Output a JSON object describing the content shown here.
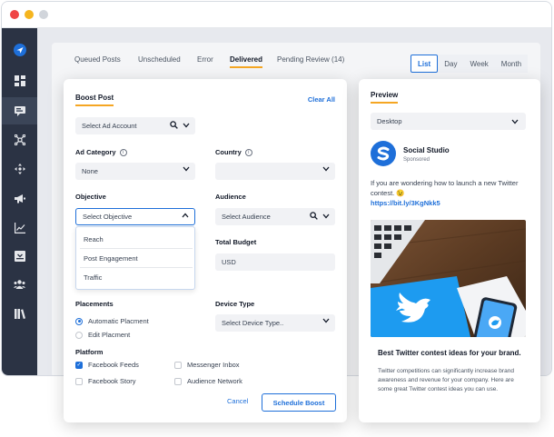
{
  "nav": {
    "tabs": [
      "Queued Posts",
      "Unscheduled",
      "Error",
      "Delivered",
      "Pending Review (14)"
    ],
    "views": [
      "List",
      "Day",
      "Week",
      "Month"
    ]
  },
  "boost": {
    "title": "Boost Post",
    "clear_all": "Clear All",
    "ad_account_placeholder": "Select Ad Account",
    "ad_category_label": "Ad Category",
    "ad_category_value": "None",
    "country_label": "Country",
    "country_value": "",
    "objective_label": "Objective",
    "objective_placeholder": "Select Objective",
    "objective_options": [
      "Reach",
      "Post Engagement",
      "Traffic"
    ],
    "audience_label": "Audience",
    "audience_placeholder": "Select Audience",
    "budget_label": "Total Budget",
    "budget_currency": "USD",
    "placements_label": "Placements",
    "placement_auto": "Automatic Placment",
    "placement_edit": "Edit Placment",
    "device_type_label": "Device Type",
    "device_type_placeholder": "Select Device Type..",
    "platform_label": "Platform",
    "platform_facebook_feeds": "Facebook Feeds",
    "platform_messenger_inbox": "Messenger Inbox",
    "platform_facebook_story": "Facebook Story",
    "platform_audience_network": "Audience Network",
    "cancel": "Cancel",
    "schedule": "Schedule Boost"
  },
  "preview": {
    "title": "Preview",
    "device": "Desktop",
    "brand_name": "Social Studio",
    "brand_sub": "Sponsored",
    "post_text": "If you are wondering how to launch a new Twitter contest. 😉",
    "post_link": "https://bit.ly/3KgNkk5",
    "headline": "Best Twitter contest ideas for your brand.",
    "description": "Twitter competitions can significantly increase brand awareness and revenue for your company. Here are some great Twitter contest ideas you can use."
  },
  "colors": {
    "accent": "#1e6fd9",
    "tab_underline": "#f5a623",
    "sidebar": "#2b3344"
  },
  "icons": {
    "sidebar": [
      "send-icon",
      "dashboard-icon",
      "posts-icon",
      "network-icon",
      "move-icon",
      "megaphone-icon",
      "analytics-icon",
      "inbox-icon",
      "users-icon",
      "library-icon"
    ]
  }
}
